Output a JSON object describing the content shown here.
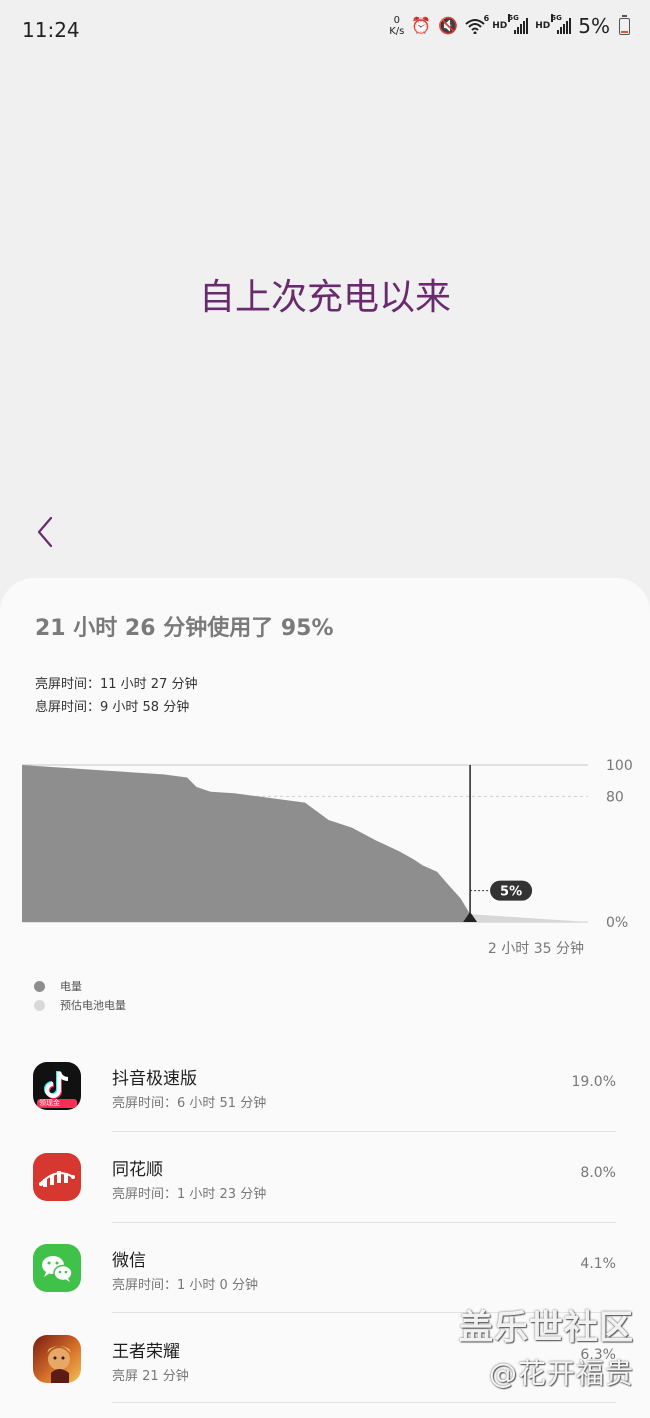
{
  "status_bar": {
    "time": "11:24",
    "net_speed_value": "0",
    "net_speed_unit": "K/s",
    "hd_label_1": "HD",
    "hd_label_2": "HD",
    "sim1_tag": "5G",
    "sim2_tag": "5G",
    "wifi_tag": "6",
    "battery_percent": "5%",
    "icons": [
      "alarm-icon",
      "mute-icon",
      "wifi-icon",
      "signal-icon",
      "battery-icon"
    ]
  },
  "header": {
    "title": "自上次充电以来"
  },
  "summary": {
    "headline": "21 小时 26 分钟使用了 95%",
    "screen_on": "亮屏时间：11 小时 27 分钟",
    "screen_off": "息屏时间：9 小时 58 分钟"
  },
  "chart_data": {
    "type": "area",
    "y_ticks": [
      "100",
      "80",
      "0%"
    ],
    "ylim": [
      0,
      100
    ],
    "grid": true,
    "series": [
      {
        "name": "电量",
        "color": "#8e8e8e",
        "x": [
          0,
          5,
          10,
          15,
          20,
          25,
          30,
          35,
          37,
          40,
          45,
          50,
          55,
          60,
          65,
          70,
          75,
          80,
          83,
          85,
          88,
          90,
          93,
          95
        ],
        "y": [
          100,
          99,
          98,
          97,
          96,
          95,
          94,
          92,
          86,
          83,
          82,
          80,
          78,
          76,
          65,
          60,
          52,
          45,
          40,
          36,
          32,
          25,
          15,
          5
        ]
      },
      {
        "name": "预估电池电量",
        "color": "#d7d7d7",
        "x": [
          95,
          100,
          105,
          110,
          115,
          120
        ],
        "y": [
          5,
          4,
          3,
          2,
          1,
          0
        ]
      }
    ],
    "current_marker_label": "5%",
    "remaining_label": "2 小时 35 分钟"
  },
  "legend": [
    {
      "label": "电量",
      "color": "#8e8e8e"
    },
    {
      "label": "预估电池电量",
      "color": "#d9d9d9"
    }
  ],
  "apps": [
    {
      "name": "抖音极速版",
      "detail": "亮屏时间：6 小时 51 分钟",
      "percent": "19.0%",
      "icon": "douyin-lite-icon",
      "badge": "领现金"
    },
    {
      "name": "同花顺",
      "detail": "亮屏时间：1 小时 23 分钟",
      "percent": "8.0%",
      "icon": "tonghuashun-icon"
    },
    {
      "name": "微信",
      "detail": "亮屏时间：1 小时 0 分钟",
      "percent": "4.1%",
      "icon": "wechat-icon"
    },
    {
      "name": "王者荣耀",
      "detail": "亮屏 21 分钟",
      "percent": "6.3%",
      "icon": "honor-of-kings-icon"
    }
  ],
  "watermark": {
    "line1": "盖乐世社区",
    "line2": "@花开福贵"
  }
}
